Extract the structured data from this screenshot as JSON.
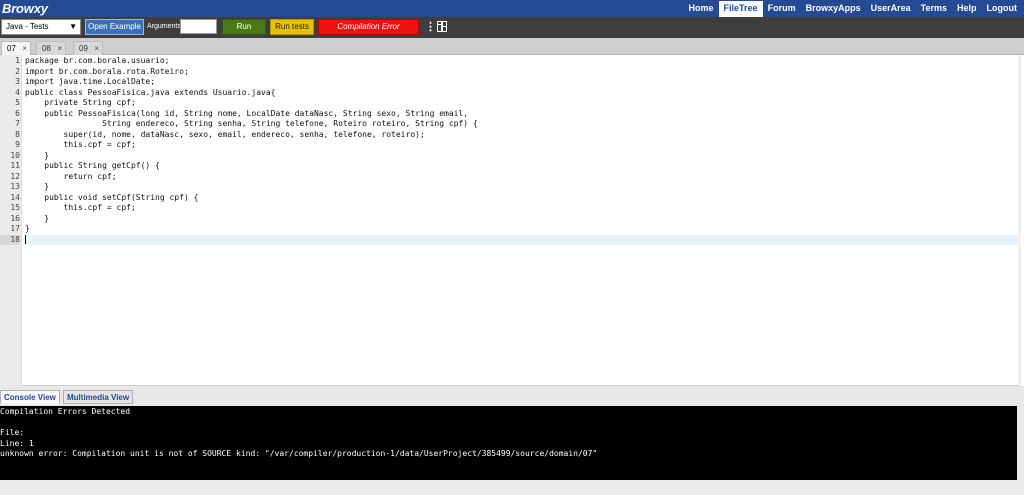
{
  "app": {
    "brand": "Browxy",
    "nav": [
      "Home",
      "FileTree",
      "Forum",
      "BrowxyApps",
      "UserArea",
      "Terms",
      "Help",
      "Logout"
    ],
    "nav_active": "FileTree"
  },
  "toolbar": {
    "language": "Java - Tests",
    "open_example": "Open Example",
    "arguments_label": "Arguments",
    "arguments_value": "",
    "run": "Run",
    "run_tests": "Run tests",
    "status": "Compilation Error",
    "colors": {
      "run": "#4a7a17",
      "tests": "#e6c000",
      "status": "#ee1111",
      "nav": "#244a93"
    }
  },
  "tabs": [
    {
      "label": "07",
      "active": true
    },
    {
      "label": "08",
      "active": false
    },
    {
      "label": "09",
      "active": false
    }
  ],
  "editor": {
    "current_line": 18,
    "lines": [
      "package br.com.borala.usuario;",
      "import br.com.borala.rota.Roteiro;",
      "import java.time.LocalDate;",
      "public class PessoaFisica.java extends Usuario.java{",
      "    private String cpf;",
      "    public PessoaFisica(long id, String nome, LocalDate dataNasc, String sexo, String email,",
      "                String endereco, String senha, String telefone, Roteiro roteiro, String cpf) {",
      "        super(id, nome, dataNasc, sexo, email, endereco, senha, telefone, roteiro);",
      "        this.cpf = cpf;",
      "    }",
      "    public String getCpf() {",
      "        return cpf;",
      "    }",
      "    public void setCpf(String cpf) {",
      "        this.cpf = cpf;",
      "    }",
      "}",
      ""
    ]
  },
  "bottom": {
    "tabs": [
      "Console View",
      "Multimedia View"
    ],
    "active_tab": "Console View",
    "console": [
      "Compilation Errors Detected",
      "",
      "File:",
      "Line: 1",
      "unknown error: Compilation unit is not of SOURCE kind: \"/var/compiler/production-1/data/UserProject/385499/source/domain/07\""
    ]
  }
}
